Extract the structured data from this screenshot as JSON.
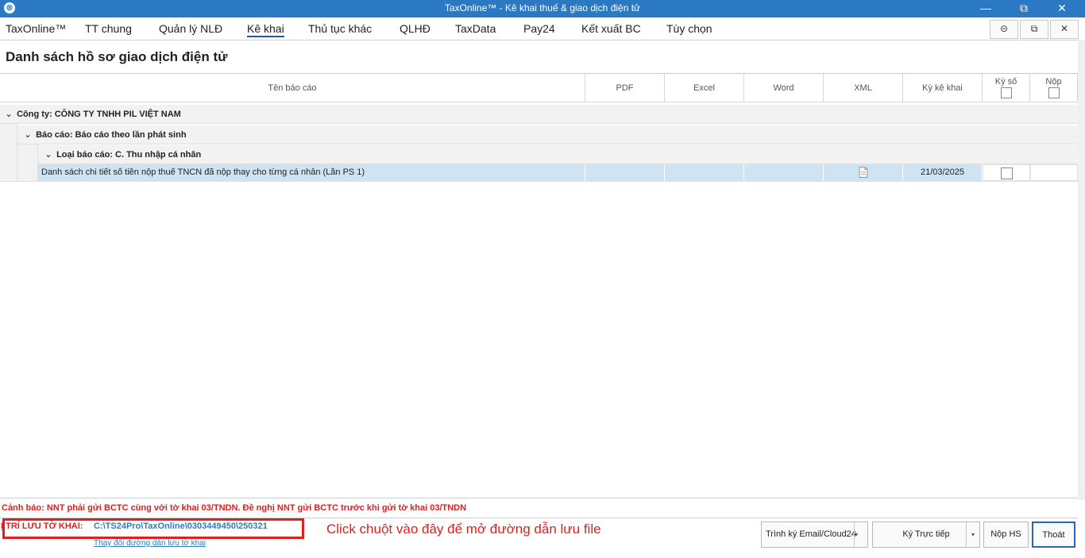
{
  "window": {
    "title": "TaxOnline™ - Kê khai thuế & giao dịch điện tử",
    "app_icon": "taxonline-logo-icon",
    "minimize": "—",
    "restore": "⧉",
    "close": "✕"
  },
  "menu": {
    "items": [
      "TaxOnline™",
      "TT chung",
      "Quản lý NLĐ",
      "Kê khai",
      "Thủ tục khác",
      "QLHĐ",
      "TaxData",
      "Pay24",
      "Kết xuất BC",
      "Tùy chọn"
    ],
    "active": "Kê khai",
    "btn_minus": "⊝",
    "btn_restore": "⧉",
    "btn_close": "✕"
  },
  "page": {
    "title": "Danh sách hồ sơ giao dịch điện tử"
  },
  "grid": {
    "headers": {
      "name": "Tên báo cáo",
      "pdf": "PDF",
      "excel": "Excel",
      "word": "Word",
      "xml": "XML",
      "period": "Kỳ kê khai",
      "sign": "Ký số",
      "submit": "Nộp"
    },
    "group1": "Công ty: CÔNG TY TNHH PIL VIỆT NAM",
    "group2": "Báo cáo: Báo cáo theo lần phát sinh",
    "group3": "Loại báo cáo: C. Thu nhập cá nhân",
    "rows": [
      {
        "name": "Danh sách chi tiết số tiền nộp thuế TNCN đã nộp thay cho từng cá nhân (Lần PS 1)",
        "pdf": "",
        "excel": "",
        "word": "",
        "xml_icon": "xml-file-icon",
        "period": "21/03/2025",
        "signed": false
      }
    ]
  },
  "footer": {
    "warning": "Cảnh báo: NNT phải gửi BCTC cùng với tờ khai 03/TNDN. Đề nghị NNT gửi BCTC trước khi gửi tờ khai 03/TNDN",
    "path_label": "Ị TRÍ LƯU TỜ KHAI:",
    "path_value": "C:\\TS24Pro\\TaxOnline\\0303449450\\250321",
    "change_path_link": "Thay đổi đường dẫn lưu tờ khai",
    "annotation": "Click chuột vào đây để mở đường dẫn lưu file",
    "buttons": {
      "sign_email": "Trình ký Email/Cloud24",
      "sign_direct": "Ký Trực tiếp",
      "submit": "Nộp HS",
      "exit": "Thoát"
    }
  },
  "colors": {
    "titlebar": "#2b79c2",
    "warning": "#e0201c",
    "link": "#2e7dc1",
    "selected_row": "#cfe4f3"
  }
}
